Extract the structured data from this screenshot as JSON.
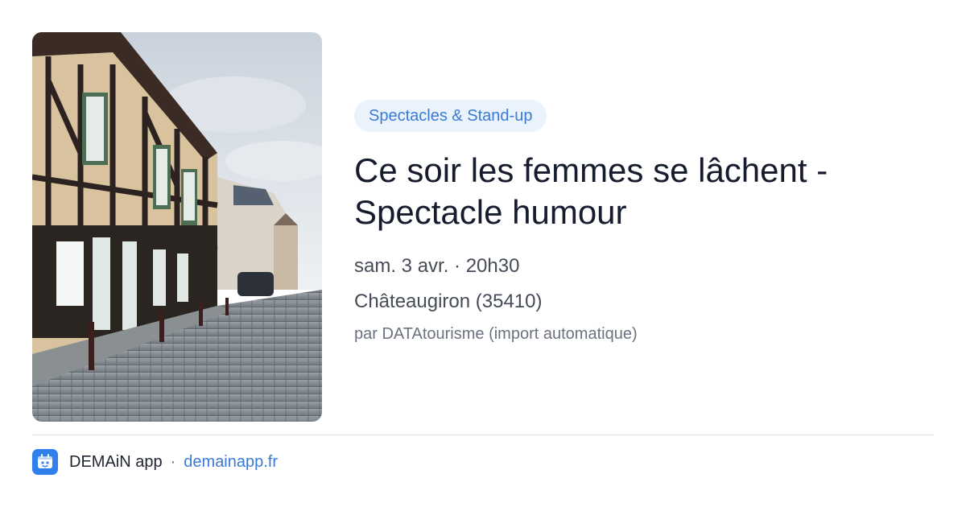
{
  "event": {
    "category": "Spectacles & Stand-up",
    "title_line1": "Ce soir les femmes se lâchent -",
    "title_line2": "Spectacle humour",
    "datetime": "sam. 3 avr. · 20h30",
    "location": "Châteaugiron (35410)",
    "source": "par DATAtourisme (import automatique)"
  },
  "footer": {
    "app_name": "DEMAiN app",
    "separator": "·",
    "site": "demainapp.fr"
  },
  "colors": {
    "accent": "#3a7bd5",
    "pill_bg": "#eaf2fc",
    "title": "#161c2d",
    "logo_bg": "#2f80ed"
  }
}
